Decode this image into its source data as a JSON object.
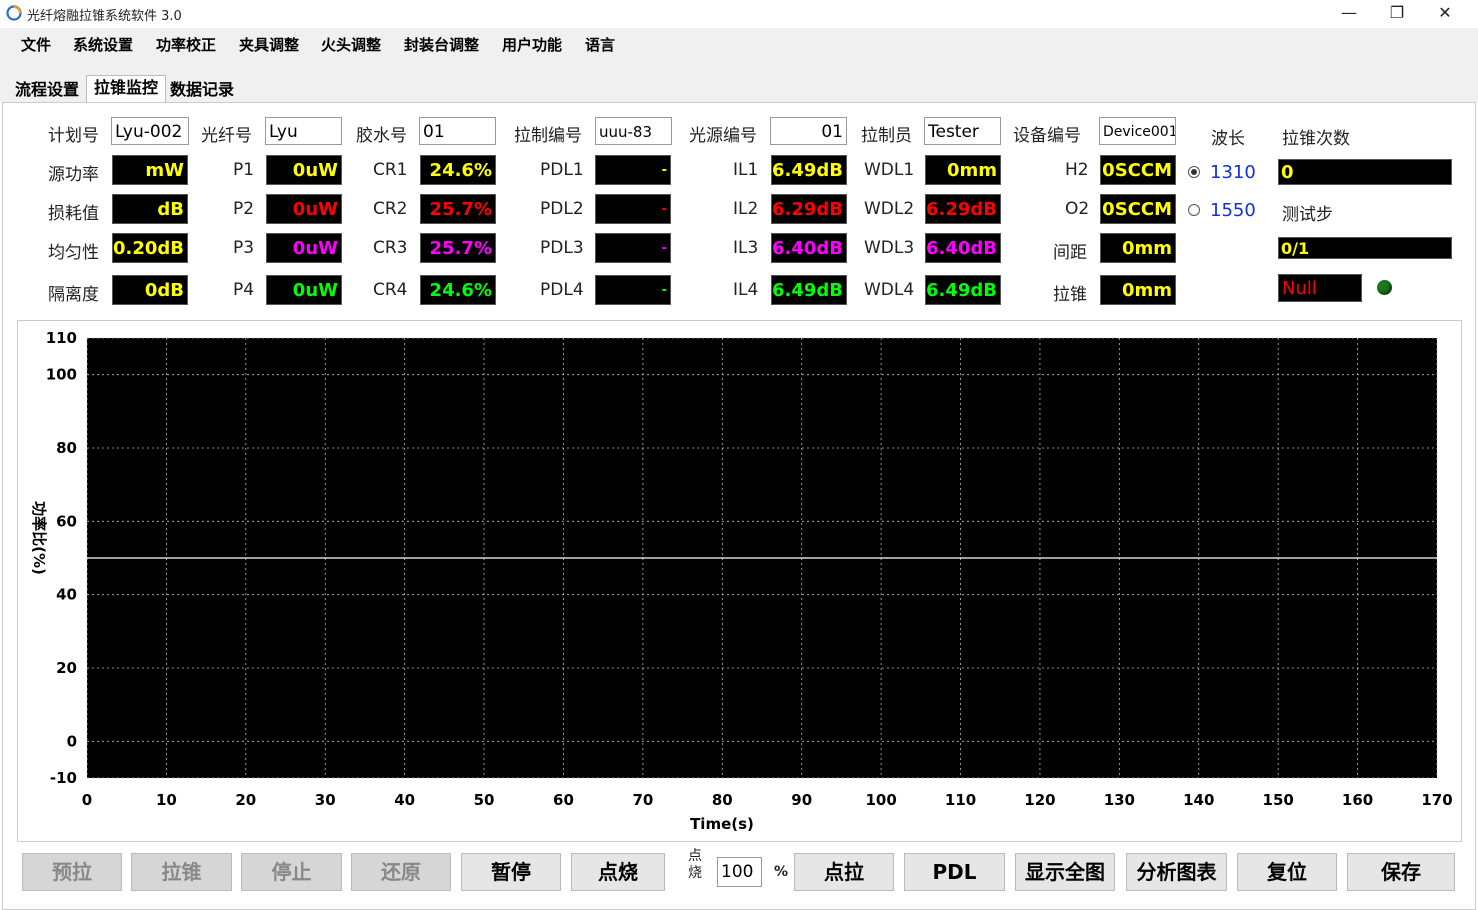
{
  "app": {
    "title": "光纤熔融拉锥系统软件 3.0"
  },
  "window_controls": {
    "minimize": "—",
    "maximize": "❐",
    "close": "✕"
  },
  "menu": [
    "文件",
    "系统设置",
    "功率校正",
    "夹具调整",
    "火头调整",
    "封装台调整",
    "用户功能",
    "语言"
  ],
  "tabs": [
    "流程设置",
    "拉锥监控",
    "数据记录"
  ],
  "active_tab": "拉锥监控",
  "info": {
    "plan_no": {
      "label": "计划号",
      "value": "Lyu-002"
    },
    "fiber_no": {
      "label": "光纤号",
      "value": "Lyu"
    },
    "glue_no": {
      "label": "胶水号",
      "value": "01"
    },
    "make_no": {
      "label": "拉制编号",
      "value": "uuu-83"
    },
    "source_no": {
      "label": "光源编号",
      "value": "01"
    },
    "operator": {
      "label": "拉制员",
      "value": "Tester"
    },
    "device_no": {
      "label": "设备编号",
      "value": "Device001"
    },
    "wavelength_label": "波长",
    "taper_count_label": "拉锥次数"
  },
  "metrics": {
    "row_labels": [
      "源功率",
      "损耗值",
      "均匀性",
      "隔离度"
    ],
    "row_values": [
      {
        "text": "mW",
        "color": "#ffff00"
      },
      {
        "text": "dB",
        "color": "#ffff00"
      },
      {
        "text": "0.20dB",
        "color": "#ffff00"
      },
      {
        "text": "0dB",
        "color": "#ffff00"
      }
    ],
    "p": [
      {
        "label": "P1",
        "value": "0uW",
        "color": "#ffff00"
      },
      {
        "label": "P2",
        "value": "0uW",
        "color": "#ff0000"
      },
      {
        "label": "P3",
        "value": "0uW",
        "color": "#ff00ff"
      },
      {
        "label": "P4",
        "value": "0uW",
        "color": "#00ff00"
      }
    ],
    "cr": [
      {
        "label": "CR1",
        "value": "24.6%",
        "color": "#ffff00"
      },
      {
        "label": "CR2",
        "value": "25.7%",
        "color": "#ff0000"
      },
      {
        "label": "CR3",
        "value": "25.7%",
        "color": "#ff00ff"
      },
      {
        "label": "CR4",
        "value": "24.6%",
        "color": "#00ff00"
      }
    ],
    "pdl": [
      {
        "label": "PDL1",
        "value": "-",
        "color": "#ffff00"
      },
      {
        "label": "PDL2",
        "value": "-",
        "color": "#ff0000"
      },
      {
        "label": "PDL3",
        "value": "-",
        "color": "#ff00ff"
      },
      {
        "label": "PDL4",
        "value": "-",
        "color": "#00ff00"
      }
    ],
    "il": [
      {
        "label": "IL1",
        "value": "6.49dB",
        "color": "#ffff00"
      },
      {
        "label": "IL2",
        "value": "6.29dB",
        "color": "#ff0000"
      },
      {
        "label": "IL3",
        "value": "6.40dB",
        "color": "#ff00ff"
      },
      {
        "label": "IL4",
        "value": "6.49dB",
        "color": "#00ff00"
      }
    ],
    "wdl": [
      {
        "label": "WDL1",
        "value": "0mm",
        "color": "#ffff00"
      },
      {
        "label": "WDL2",
        "value": "6.29dB",
        "color": "#ff0000"
      },
      {
        "label": "WDL3",
        "value": "6.40dB",
        "color": "#ff00ff"
      },
      {
        "label": "WDL4",
        "value": "6.49dB",
        "color": "#00ff00"
      }
    ],
    "gas": [
      {
        "label": "H2",
        "value": "0SCCM",
        "color": "#ffff00"
      },
      {
        "label": "O2",
        "value": "0SCCM",
        "color": "#ffff00"
      },
      {
        "label": "间距",
        "value": "0mm",
        "color": "#ffff00"
      },
      {
        "label": "拉锥",
        "value": "0mm",
        "color": "#ffff00"
      }
    ],
    "wavelengths": [
      {
        "value": "1310",
        "selected": true
      },
      {
        "value": "1550",
        "selected": false
      }
    ],
    "taper_count": "0",
    "test_step_label": "测试步",
    "test_step": "0/1",
    "status": "Null",
    "status_led_color": "#1a7a1a"
  },
  "chart_data": {
    "type": "line",
    "xlabel": "Time(s)",
    "ylabel": "功率比(%)",
    "xlim": [
      0,
      170
    ],
    "ylim": [
      -10,
      110
    ],
    "xticks": [
      0,
      10,
      20,
      30,
      40,
      50,
      60,
      70,
      80,
      90,
      100,
      110,
      120,
      130,
      140,
      150,
      160,
      170
    ],
    "yticks": [
      -10,
      0,
      20,
      40,
      60,
      80,
      100,
      110
    ],
    "grid": true,
    "background": "#000000",
    "series": [
      {
        "color": "#ffffff",
        "x": [
          0,
          170
        ],
        "y": [
          50,
          50
        ]
      }
    ]
  },
  "buttons": [
    "预拉",
    "拉锥",
    "停止",
    "还原",
    "暂停",
    "点烧",
    "点拉",
    "PDL",
    "显示全图",
    "分析图表",
    "复位",
    "保存"
  ],
  "disabled_buttons": [
    "预拉",
    "拉锥",
    "停止",
    "还原"
  ],
  "spot_burn": {
    "label_top": "点",
    "label_bottom": "烧",
    "value": "100",
    "unit": "%"
  }
}
